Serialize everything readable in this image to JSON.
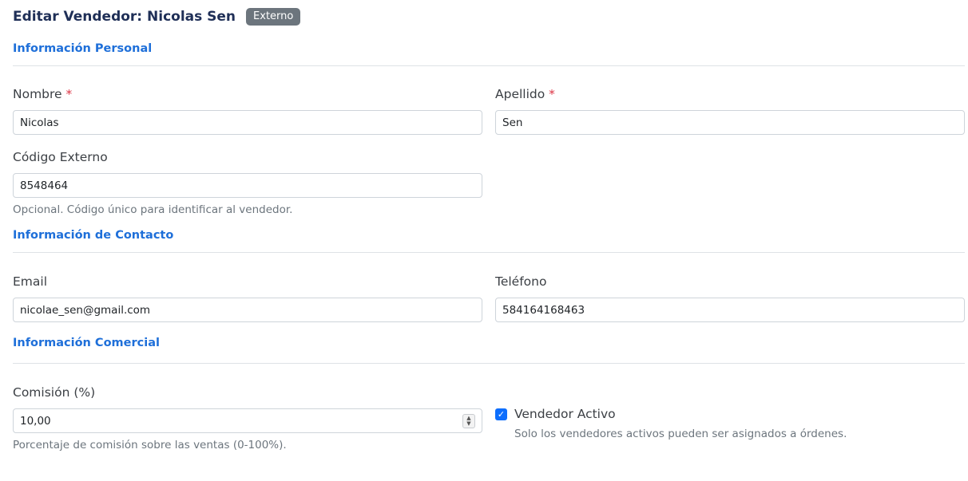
{
  "header": {
    "title": "Editar Vendedor: Nicolas Sen",
    "badge": "Externo"
  },
  "sections": {
    "personal": "Información Personal",
    "contact": "Información de Contacto",
    "commercial": "Información Comercial"
  },
  "fields": {
    "nombre": {
      "label": "Nombre",
      "required": "*",
      "value": "Nicolas"
    },
    "apellido": {
      "label": "Apellido",
      "required": "*",
      "value": "Sen"
    },
    "codigo": {
      "label": "Código Externo",
      "value": "8548464",
      "help": "Opcional. Código único para identificar al vendedor."
    },
    "email": {
      "label": "Email",
      "value": "nicolae_sen@gmail.com"
    },
    "telefono": {
      "label": "Teléfono",
      "value": "584164168463"
    },
    "comision": {
      "label": "Comisión (%)",
      "value": "10,00",
      "help": "Porcentaje de comisión sobre las ventas (0-100%)."
    },
    "activo": {
      "label": "Vendedor Activo",
      "checked": true,
      "help": "Solo los vendedores activos pueden ser asignados a órdenes."
    }
  },
  "colors": {
    "title": "#1f2f57",
    "section": "#1e6fd9",
    "badge": "#6c757d",
    "checkbox": "#0d6efd",
    "required": "#dc3545"
  }
}
